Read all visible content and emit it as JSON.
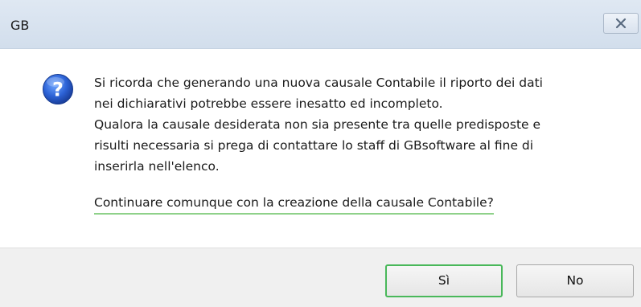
{
  "window": {
    "title": "GB",
    "close_icon": "close-icon"
  },
  "message": {
    "icon": "question-icon",
    "lines": [
      "Si ricorda che generando una nuova causale Contabile il riporto dei dati",
      "nei dichiarativi potrebbe essere inesatto ed incompleto.",
      "Qualora la causale desiderata non sia presente tra quelle predisposte e",
      "risulti necessaria si prega di contattare lo staff di GBsoftware al fine di",
      "inserirla nell'elenco."
    ],
    "question": "Continuare comunque con la creazione della causale Contabile?",
    "question_underline_color": "#8fd18a"
  },
  "buttons": {
    "yes_label": "Sì",
    "no_label": "No",
    "focus_color": "#49b85a"
  }
}
